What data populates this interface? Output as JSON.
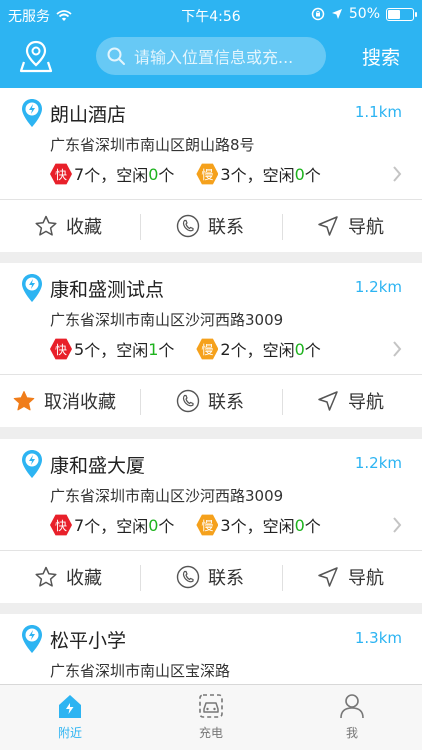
{
  "status": {
    "carrier": "无服务",
    "time": "下午4:56",
    "battery": "50%",
    "battery_level": 0.5
  },
  "header": {
    "search_placeholder": "请输入位置信息或充...",
    "search_label": "搜索"
  },
  "stations": [
    {
      "name": "朗山酒店",
      "distance": "1.1km",
      "address": "广东省深圳市南山区朗山路8号",
      "fast_badge": "快",
      "fast_total": "7",
      "fast_free": "0",
      "slow_badge": "慢",
      "slow_total": "3",
      "slow_free": "0",
      "fav_label": "收藏",
      "favorited": false,
      "contact_label": "联系",
      "nav_label": "导航"
    },
    {
      "name": "康和盛测试点",
      "distance": "1.2km",
      "address": "广东省深圳市南山区沙河西路3009",
      "fast_badge": "快",
      "fast_total": "5",
      "fast_free": "1",
      "slow_badge": "慢",
      "slow_total": "2",
      "slow_free": "0",
      "fav_label": "取消收藏",
      "favorited": true,
      "contact_label": "联系",
      "nav_label": "导航"
    },
    {
      "name": "康和盛大厦",
      "distance": "1.2km",
      "address": "广东省深圳市南山区沙河西路3009",
      "fast_badge": "快",
      "fast_total": "7",
      "fast_free": "0",
      "slow_badge": "慢",
      "slow_total": "3",
      "slow_free": "0",
      "fav_label": "收藏",
      "favorited": false,
      "contact_label": "联系",
      "nav_label": "导航"
    },
    {
      "name": "松平小学",
      "distance": "1.3km",
      "address": "广东省深圳市南山区宝深路"
    }
  ],
  "count_text": {
    "unit": "个，空闲",
    "unit_end": "个"
  },
  "tabs": [
    {
      "label": "附近",
      "icon": "nearby-icon",
      "active": true
    },
    {
      "label": "充电",
      "icon": "charge-icon",
      "active": false
    },
    {
      "label": "我",
      "icon": "profile-icon",
      "active": false
    }
  ],
  "colors": {
    "accent": "#2db4f2",
    "fast": "#e8202a",
    "slow": "#f5a11c",
    "free": "#1db21d",
    "star_active": "#f07d1a"
  }
}
